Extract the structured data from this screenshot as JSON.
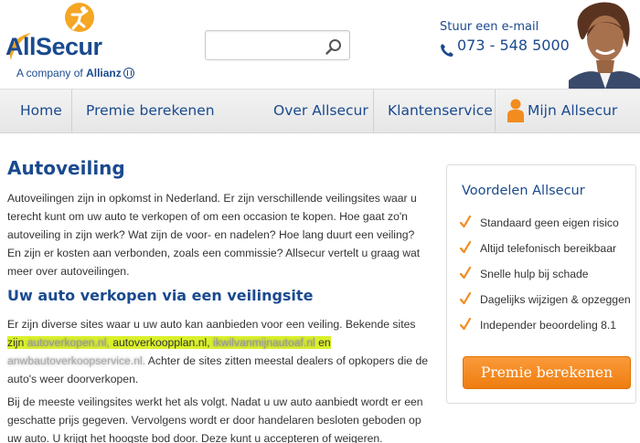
{
  "header": {
    "brand": "AllSecur",
    "brand_sub_prefix": "A company of",
    "brand_sub_parent": "Allianz",
    "search": {
      "value": "",
      "placeholder": ""
    },
    "contact": {
      "email_label": "Stuur een e-mail",
      "phone": "073 - 548 5000"
    }
  },
  "nav": {
    "items": [
      {
        "label": "Home"
      },
      {
        "label": "Premie berekenen"
      },
      {
        "label": "Over Allsecur"
      },
      {
        "label": "Klantenservice"
      },
      {
        "label": "Mijn Allsecur"
      }
    ]
  },
  "main": {
    "title": "Autoveiling",
    "intro": "Autoveilingen zijn in opkomst in Nederland. Er zijn verschillende veilingsites waar u terecht kunt om uw auto te verkopen of om een occasion te kopen. Hoe gaat zo'n autoveiling in zijn werk? Wat zijn de voor- en nadelen? Hoe lang duurt een veiling? En zijn er kosten aan verbonden, zoals een commissie? Allsecur vertelt u graag wat meer over autoveilingen.",
    "section_title": "Uw auto verkopen via een veilingsite",
    "para2_start": "Er zijn diverse sites waar u uw auto kan aanbieden voor een veiling. Bekende sites",
    "para2_zijn": "zijn",
    "para2_site1": "autoverkopen.nl,",
    "para2_site2": "autoverkoopplan.nl,",
    "para2_site3": "ikwilvanmijnautoaf.nl",
    "para2_en": "en",
    "para2_site4": "anwbautoverkoopservice.nl.",
    "para2_end": "Achter de sites zitten meestal dealers of opkopers die de auto's weer doorverkopen.",
    "para3": "Bij de meeste veilingsites werkt het als volgt. Nadat u uw auto aanbiedt wordt er een geschatte prijs gegeven. Vervolgens wordt er door handelaren besloten geboden op uw auto. U krijgt het hoogste bod door. Deze kunt u accepteren of weigeren."
  },
  "sidebar": {
    "title": "Voordelen Allsecur",
    "items": [
      {
        "label": "Standaard geen eigen risico"
      },
      {
        "label": "Altijd telefonisch bereikbaar"
      },
      {
        "label": "Snelle hulp bij schade"
      },
      {
        "label": "Dagelijks wijzigen & opzeggen"
      },
      {
        "label": "Independer beoordeling 8.1"
      }
    ],
    "cta_label": "Premie berekenen"
  },
  "colors": {
    "brand_blue": "#1a4a8e",
    "accent_orange": "#f28c1e",
    "highlight": "#d9f02a"
  }
}
